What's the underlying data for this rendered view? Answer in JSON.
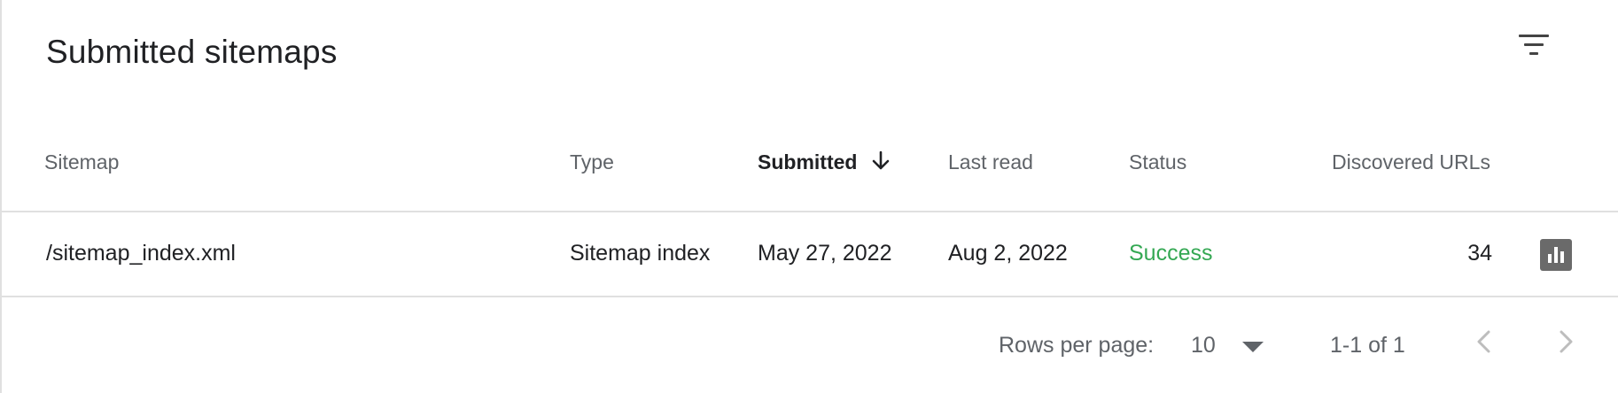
{
  "header": {
    "title": "Submitted sitemaps",
    "filter_icon": "filter-list-icon"
  },
  "table": {
    "columns": [
      {
        "label": "Sitemap"
      },
      {
        "label": "Type"
      },
      {
        "label": "Submitted",
        "sorted": "descending"
      },
      {
        "label": "Last read"
      },
      {
        "label": "Status"
      },
      {
        "label": "Discovered URLs"
      }
    ],
    "rows": [
      {
        "sitemap": "/sitemap_index.xml",
        "type": "Sitemap index",
        "submitted": "May 27, 2022",
        "last_read": "Aug 2, 2022",
        "status": "Success",
        "discovered_urls": "34",
        "action_icon": "bar-chart-icon"
      }
    ]
  },
  "pagination": {
    "rows_per_page_label": "Rows per page:",
    "rows_per_page_value": "10",
    "range": "1-1 of 1"
  },
  "colors": {
    "status_success": "#34a853",
    "header_text": "#5f6368",
    "divider": "#e0e0e0"
  }
}
